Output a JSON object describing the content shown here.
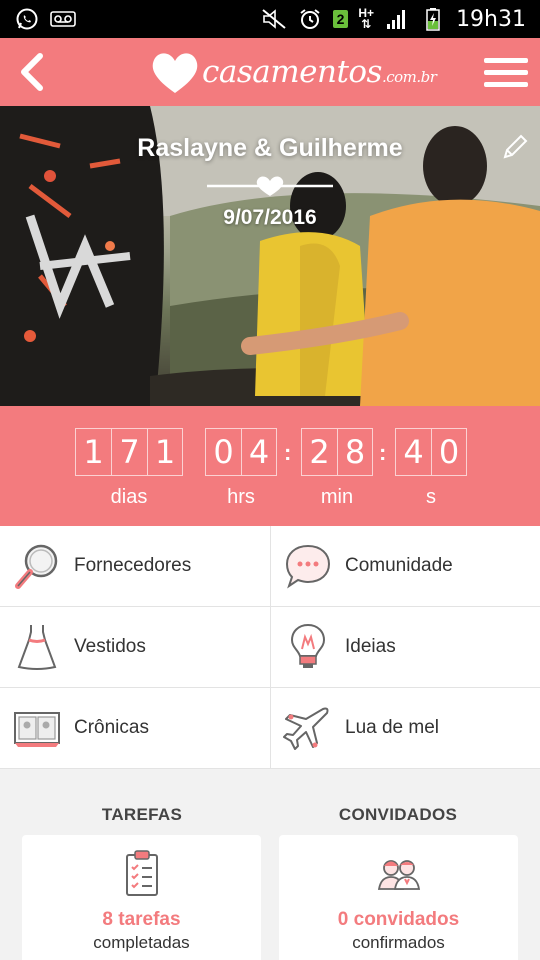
{
  "status_bar": {
    "time": "19h31",
    "notification_badge": "2",
    "network_label": "H+"
  },
  "app_bar": {
    "logo_text": "casamentos",
    "logo_domain": ".com.br",
    "back_icon": "chevron-left-icon",
    "menu_icon": "hamburger-menu-icon"
  },
  "hero": {
    "couple_names": "Raslayne & Guilherme",
    "wedding_date": "9/07/2016",
    "edit_icon": "pencil-icon"
  },
  "countdown": {
    "days": "171",
    "hours": "04",
    "minutes": "28",
    "seconds": "40",
    "days_label": "dias",
    "hours_label": "hrs",
    "minutes_label": "min",
    "seconds_label": "s"
  },
  "menu": {
    "items": [
      {
        "label": "Fornecedores",
        "icon": "magnifier-icon"
      },
      {
        "label": "Comunidade",
        "icon": "chat-bubble-icon"
      },
      {
        "label": "Vestidos",
        "icon": "dress-icon"
      },
      {
        "label": "Ideias",
        "icon": "lightbulb-icon"
      },
      {
        "label": "Crônicas",
        "icon": "photo-album-icon"
      },
      {
        "label": "Lua de mel",
        "icon": "airplane-icon"
      }
    ]
  },
  "tasks": {
    "heading": "TAREFAS",
    "count_text": "8 tarefas",
    "sub_text": "completadas",
    "icon": "clipboard-checklist-icon"
  },
  "guests": {
    "heading": "CONVIDADOS",
    "count_text": "0 convidados",
    "sub_text": "confirmados",
    "icon": "guests-couple-icon"
  },
  "colors": {
    "brand": "#f37b7e",
    "status_bar": "#000000"
  }
}
